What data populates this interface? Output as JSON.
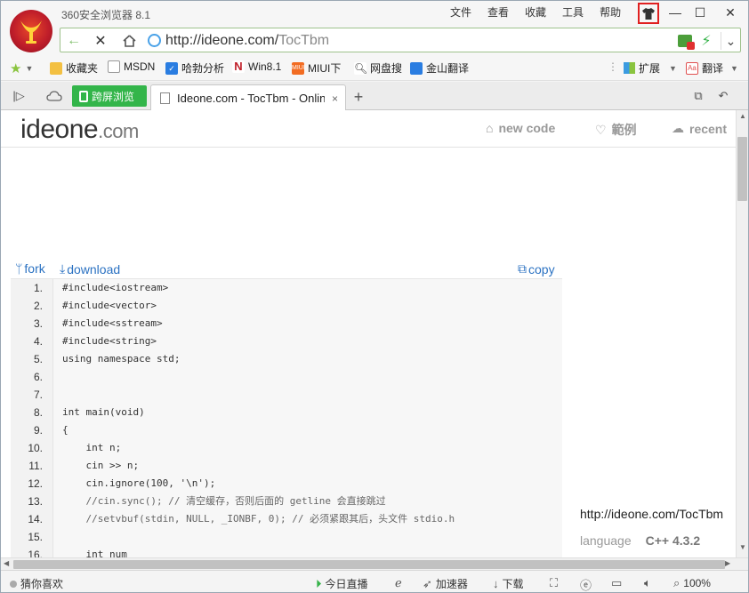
{
  "window": {
    "app_title": "360安全浏览器 8.1",
    "menu": [
      "文件",
      "查看",
      "收藏",
      "工具",
      "帮助"
    ],
    "skin_icon": "tshirt-icon",
    "controls": {
      "minimize": "—",
      "maximize": "☐",
      "close": "✕"
    }
  },
  "address_bar": {
    "url_host": "http://ideone.com/",
    "url_path": "TocTbm"
  },
  "bookmarks": [
    {
      "label": "收藏夹",
      "icon": "folder-icon",
      "color": "#f3c042"
    },
    {
      "label": "MSDN",
      "icon": "page-icon",
      "color": "#9a9a9a"
    },
    {
      "label": "哈勃分析",
      "icon": "shield-icon",
      "color": "#2a7de1"
    },
    {
      "label": "Win8.1",
      "icon": "n-icon",
      "color": "#c0202a"
    },
    {
      "label": "MIUI下",
      "icon": "miui-icon",
      "color": "#f26c22"
    },
    {
      "label": "网盘搜",
      "icon": "magnifier-icon",
      "color": "#333333"
    },
    {
      "label": "金山翻译",
      "icon": "translate-icon",
      "color": "#2a7de1"
    }
  ],
  "toolbar_right": {
    "extend": "扩展",
    "translate": "翻译"
  },
  "tabs": {
    "green_tab": "跨屏浏览",
    "active_title": "Ideone.com - TocTbm - Online",
    "close": "×",
    "new": "+"
  },
  "site": {
    "logo_main": "ideone",
    "logo_domain": ".com",
    "nav": [
      {
        "label": "new code",
        "icon": "home-icon"
      },
      {
        "label": "範例",
        "icon": "bulb-icon"
      },
      {
        "label": "recent",
        "icon": "cloud-icon"
      }
    ],
    "fork": "fork",
    "download": "download",
    "copy": "copy",
    "code_lines": [
      {
        "num": "1.",
        "text": "#include<iostream>"
      },
      {
        "num": "2.",
        "text": "#include<vector>"
      },
      {
        "num": "3.",
        "text": "#include<sstream>"
      },
      {
        "num": "4.",
        "text": "#include<string>"
      },
      {
        "num": "5.",
        "text": "using namespace std;"
      },
      {
        "num": "6.",
        "text": ""
      },
      {
        "num": "7.",
        "text": ""
      },
      {
        "num": "8.",
        "text": "int main(void)"
      },
      {
        "num": "9.",
        "text": "{"
      },
      {
        "num": "10.",
        "text": "    int n;"
      },
      {
        "num": "11.",
        "text": "    cin >> n;"
      },
      {
        "num": "12.",
        "text": "    cin.ignore(100, '\\n');"
      },
      {
        "num": "13.",
        "text": "    //cin.sync(); // 清空缓存，否则后面的 getline 会直接跳过"
      },
      {
        "num": "14.",
        "text": "    //setvbuf(stdin, NULL, _IONBF, 0); // 必须紧跟其后，头文件 stdio.h"
      },
      {
        "num": "15.",
        "text": ""
      },
      {
        "num": "16.",
        "text": "    int num"
      }
    ],
    "embed_url": "http://ideone.com/TocTbm",
    "language_label": "language",
    "language_value": "C++ 4.3.2"
  },
  "status_bar": {
    "left": "猜你喜欢",
    "live": "今日直播",
    "accelerator": "加速器",
    "download": "下载",
    "zoom": "100%"
  }
}
